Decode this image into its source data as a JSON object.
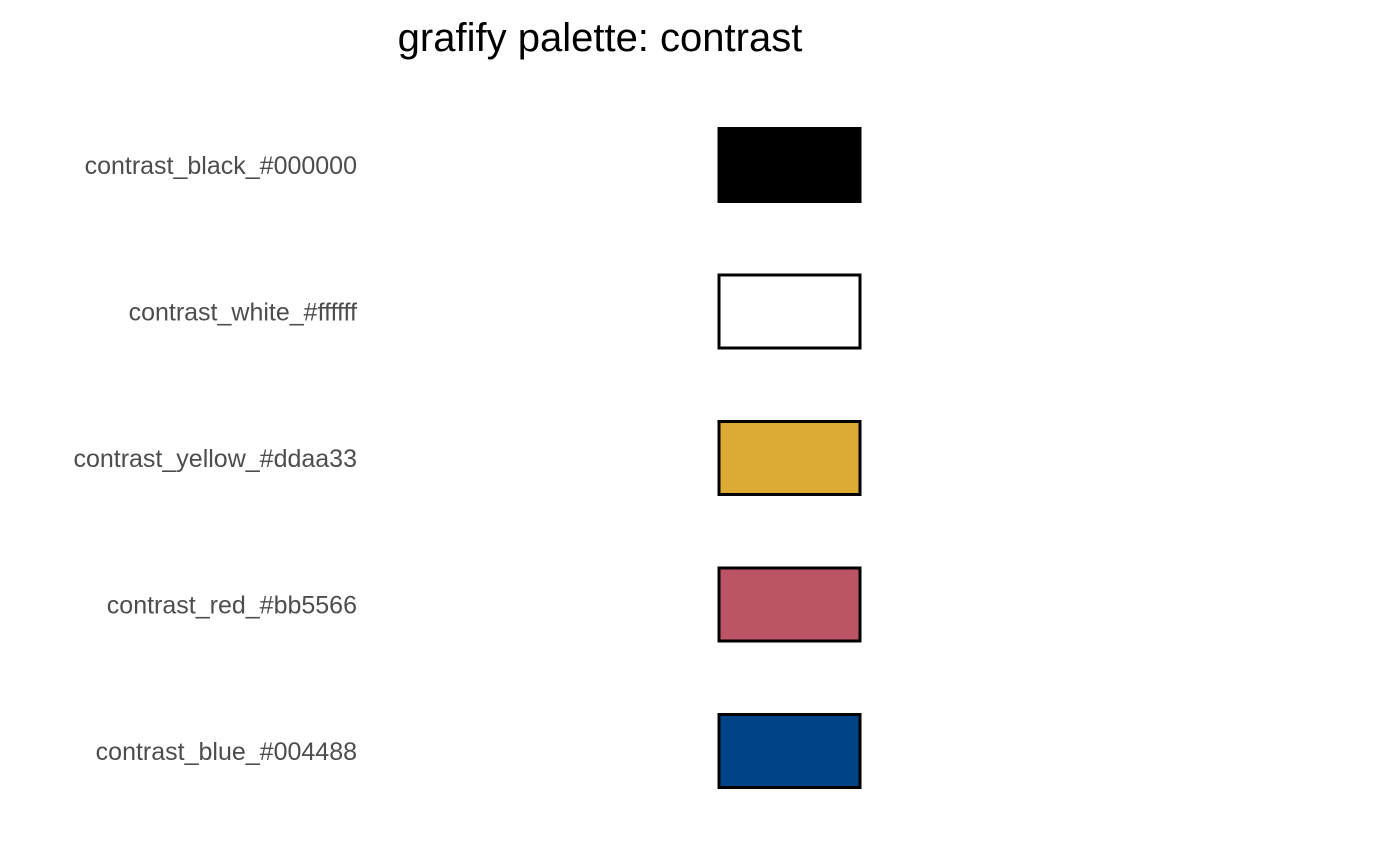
{
  "chart_data": {
    "type": "bar",
    "title": "grafify palette: contrast",
    "xlabel": "",
    "ylabel": "",
    "grid": false,
    "legend": "none",
    "categories": [
      "contrast_black_#000000",
      "contrast_white_#ffffff",
      "contrast_yellow_#ddaa33",
      "contrast_red_#bb5566",
      "contrast_blue_#004488"
    ],
    "colors": [
      "#000000",
      "#ffffff",
      "#ddaa33",
      "#bb5566",
      "#004488"
    ],
    "outline_color": "#000000"
  }
}
